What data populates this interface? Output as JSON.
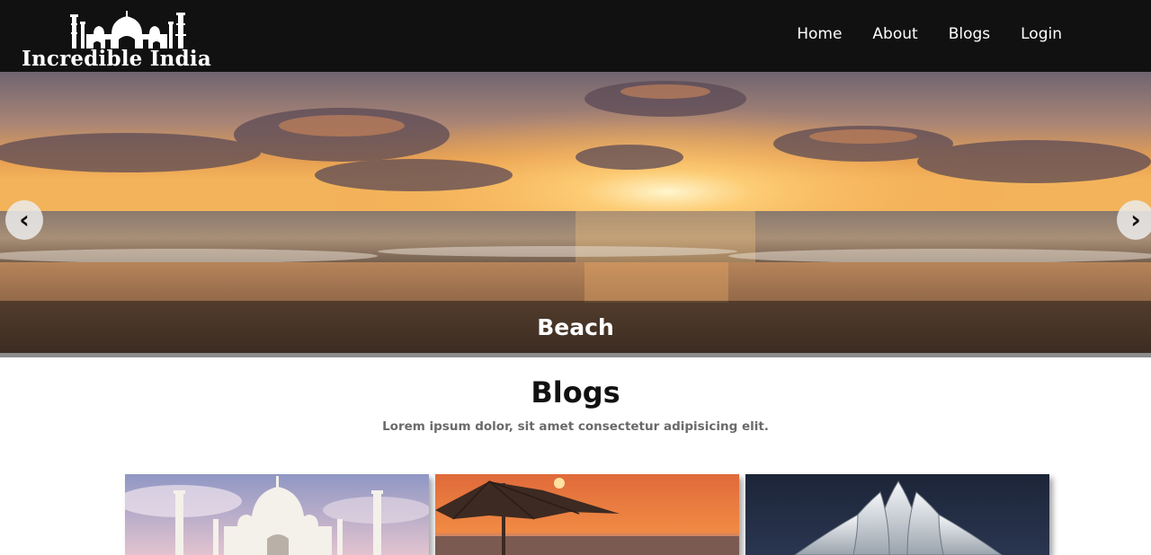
{
  "brand": {
    "name": "Incredible India"
  },
  "nav": {
    "items": [
      {
        "label": "Home"
      },
      {
        "label": "About"
      },
      {
        "label": "Blogs"
      },
      {
        "label": "Login"
      }
    ]
  },
  "slider": {
    "caption": "Beach",
    "prev_icon": "‹",
    "next_icon": "›"
  },
  "blogs": {
    "title": "Blogs",
    "subtitle": "Lorem ipsum dolor, sit amet consectetur adipisicing elit."
  },
  "colors": {
    "header_bg": "#111111",
    "caption_bg": "#2a2119",
    "arrow_bg": "#ebebeb"
  }
}
